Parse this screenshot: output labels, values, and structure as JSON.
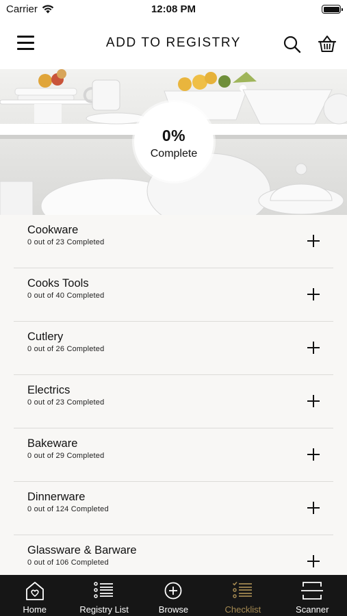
{
  "status_bar": {
    "carrier": "Carrier",
    "time": "12:08 PM"
  },
  "header": {
    "title": "ADD TO REGISTRY",
    "icons": [
      "menu-icon",
      "search-icon",
      "basket-icon"
    ]
  },
  "progress": {
    "value": "0%",
    "label": "Complete"
  },
  "categories": [
    {
      "name": "Cookware",
      "status": "0 out of 23 Completed"
    },
    {
      "name": "Cooks Tools",
      "status": "0 out of 40 Completed"
    },
    {
      "name": "Cutlery",
      "status": "0 out of 26 Completed"
    },
    {
      "name": "Electrics",
      "status": "0 out of 23 Completed"
    },
    {
      "name": "Bakeware",
      "status": "0 out of 29 Completed"
    },
    {
      "name": "Dinnerware",
      "status": "0 out of 124 Completed"
    },
    {
      "name": "Glassware & Barware",
      "status": "0 out of 106 Completed"
    }
  ],
  "tabbar": {
    "active": "Checklist",
    "tabs": [
      {
        "label": "Home",
        "icon": "home-heart-icon"
      },
      {
        "label": "Registry List",
        "icon": "list-icon"
      },
      {
        "label": "Browse",
        "icon": "plus-circle-icon"
      },
      {
        "label": "Checklist",
        "icon": "checklist-icon"
      },
      {
        "label": "Scanner",
        "icon": "scanner-icon"
      }
    ]
  },
  "colors": {
    "tabbar_bg": "#161616",
    "accent_active": "#a58a52",
    "list_bg": "#f8f7f5"
  }
}
